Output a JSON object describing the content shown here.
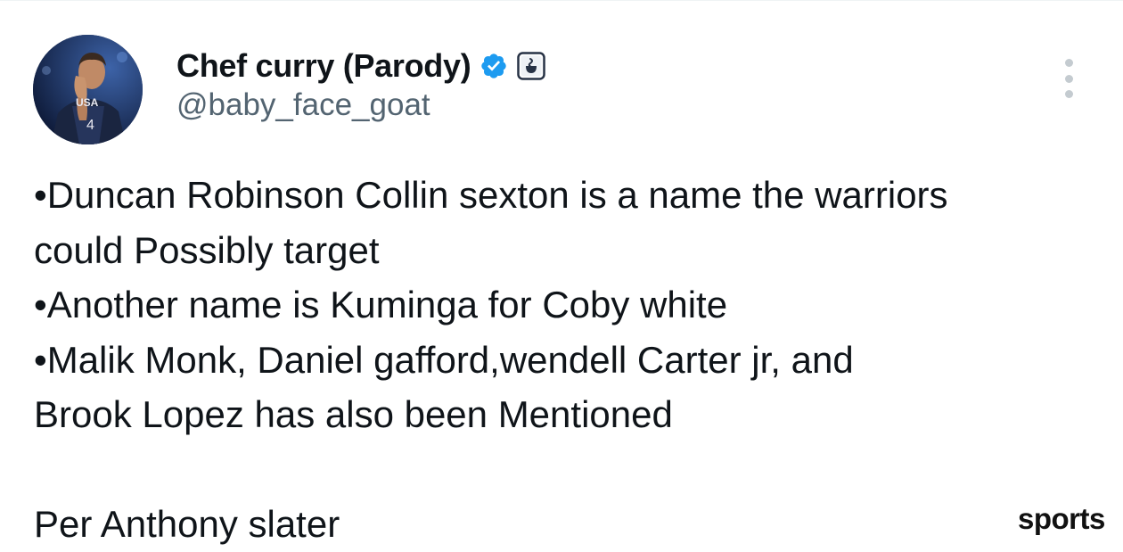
{
  "author": {
    "display_name": "Chef curry (Parody)",
    "handle": "@baby_face_goat",
    "avatar_jersey_text": "USA",
    "avatar_jersey_number": "4"
  },
  "tweet": {
    "lines": [
      "•Duncan Robinson Collin sexton is a name the warriors",
      "could Possibly target",
      "•Another name is Kuminga for Coby white",
      "•Malik Monk, Daniel gafford,wendell Carter jr, and",
      "Brook Lopez has also been Mentioned",
      "",
      "Per Anthony slater"
    ]
  },
  "watermark": "sports",
  "icons": {
    "verified": "verified-badge-icon",
    "affiliate": "affiliate-badge-icon",
    "more": "more-options-icon"
  },
  "colors": {
    "verified_blue": "#1d9bf0",
    "text_primary": "#0f1419",
    "text_secondary": "#536471"
  }
}
